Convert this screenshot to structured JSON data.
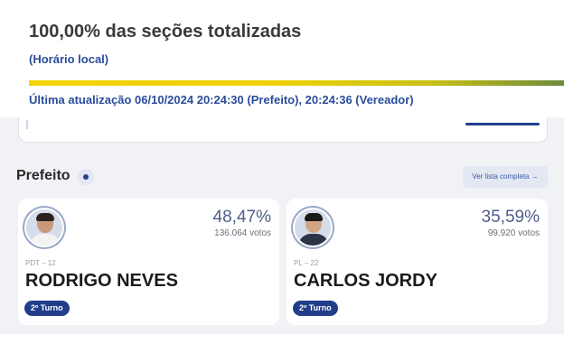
{
  "header": {
    "headline": "100,00% das seções totalizadas",
    "local_time_note": "(Horário local)",
    "progress_percent": 100,
    "last_update": "Última atualização 06/10/2024 20:24:30 (Prefeito), 20:24:36 (Vereador)"
  },
  "section": {
    "title": "Prefeito",
    "info_icon": "info-icon",
    "see_list_label": "Ver lista completa →"
  },
  "candidates": [
    {
      "percentage": "48,47%",
      "votes": "136.064 votos",
      "party": "PDT – 12",
      "name": "RODRIGO NEVES",
      "round_badge": "2º Turno"
    },
    {
      "percentage": "35,59%",
      "votes": "99.920 votos",
      "party": "PL – 22",
      "name": "CARLOS JORDY",
      "round_badge": "2º Turno"
    }
  ],
  "colors": {
    "accent_blue": "#223e8b",
    "progress_yellow": "#f3d300",
    "page_gray": "#f1f2f6"
  }
}
